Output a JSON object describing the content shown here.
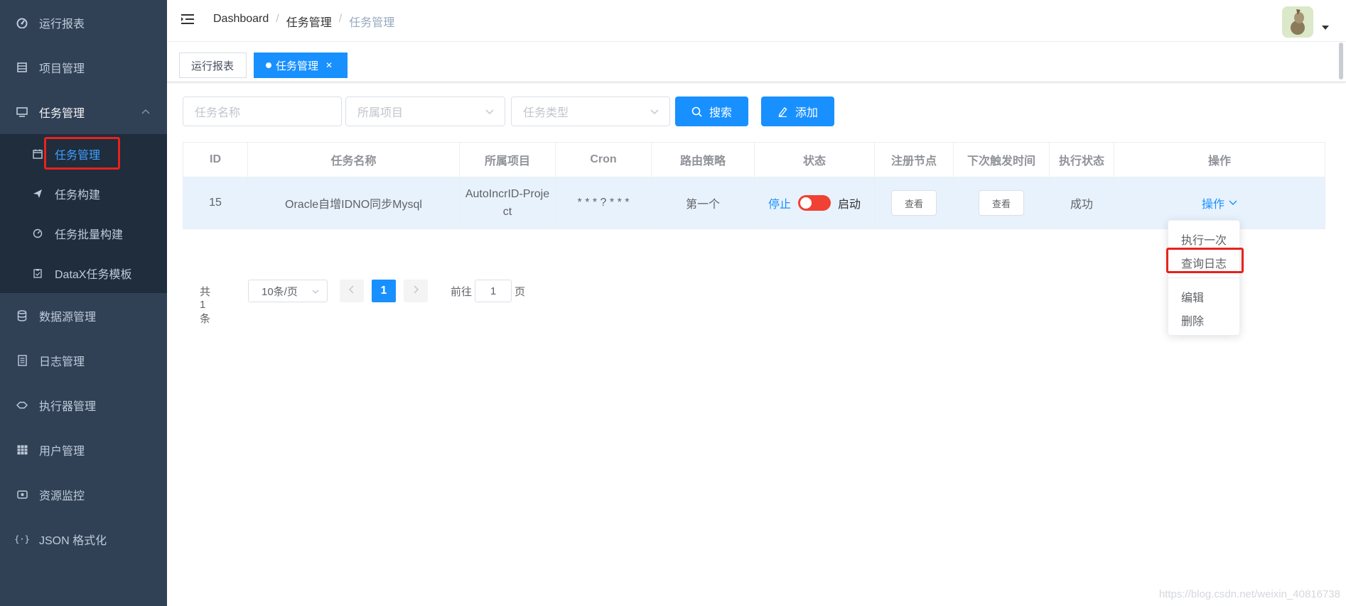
{
  "sidebar": {
    "items": [
      {
        "label": "运行报表",
        "icon": "dashboard-icon"
      },
      {
        "label": "项目管理",
        "icon": "project-icon"
      },
      {
        "label": "任务管理",
        "icon": "monitor-icon",
        "expanded": true
      },
      {
        "label": "数据源管理",
        "icon": "database-icon"
      },
      {
        "label": "日志管理",
        "icon": "document-icon"
      },
      {
        "label": "执行器管理",
        "icon": "executor-icon"
      },
      {
        "label": "用户管理",
        "icon": "table-icon"
      },
      {
        "label": "资源监控",
        "icon": "monitor-resource-icon"
      },
      {
        "label": "JSON 格式化",
        "icon": "json-icon"
      }
    ],
    "sub_items": [
      {
        "label": "任务管理",
        "icon": "calendar-icon",
        "active": true
      },
      {
        "label": "任务构建",
        "icon": "paper-plane-icon"
      },
      {
        "label": "任务批量构建",
        "icon": "gauge-icon"
      },
      {
        "label": "DataX任务模板",
        "icon": "clipboard-icon"
      }
    ]
  },
  "breadcrumb": [
    "Dashboard",
    "任务管理",
    "任务管理"
  ],
  "tags": [
    {
      "label": "运行报表",
      "active": false
    },
    {
      "label": "任务管理",
      "active": true
    }
  ],
  "filters": {
    "task_name_placeholder": "任务名称",
    "project_placeholder": "所属项目",
    "task_type_placeholder": "任务类型",
    "search_label": "搜索",
    "add_label": "添加"
  },
  "table": {
    "columns": [
      "ID",
      "任务名称",
      "所属项目",
      "Cron",
      "路由策略",
      "状态",
      "注册节点",
      "下次触发时间",
      "执行状态",
      "操作"
    ],
    "rows": [
      {
        "id": "15",
        "name": "Oracle自增IDNO同步Mysql",
        "project": "AutoIncrID-Project",
        "cron": "* * * ? * * *",
        "route": "第一个",
        "status_off": "停止",
        "status_on": "启动",
        "registry_btn": "查看",
        "next_btn": "查看",
        "exec_status": "成功",
        "action": "操作"
      }
    ]
  },
  "dropdown": {
    "items": [
      "执行一次",
      "查询日志",
      "编辑",
      "删除"
    ]
  },
  "pagination": {
    "total": "共 1 条",
    "page_size": "10条/页",
    "current_page": "1",
    "goto_label": "前往",
    "goto_value": "1",
    "page_label": "页"
  },
  "watermark": "https://blog.csdn.net/weixin_40816738",
  "colors": {
    "sidebar_bg": "#304156",
    "submenu_bg": "#1f2d3d",
    "primary": "#1890ff",
    "highlight": "#e8221c",
    "switch_off": "#f04134"
  }
}
